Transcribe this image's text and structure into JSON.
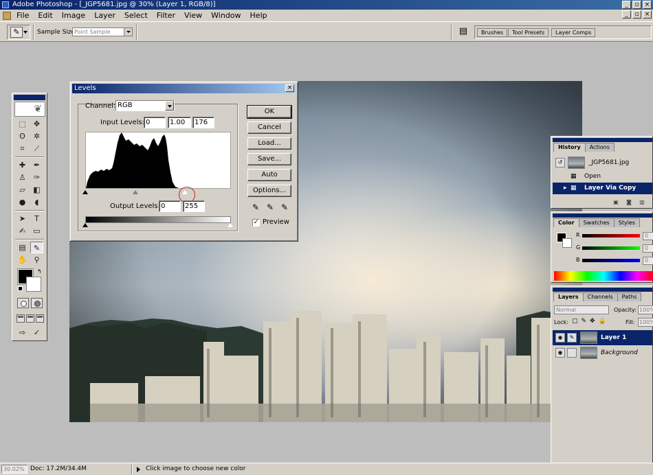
{
  "window": {
    "title": "Adobe Photoshop - [_JGP5681.jpg @ 30% (Layer 1, RGB/8)]"
  },
  "menu": [
    "File",
    "Edit",
    "Image",
    "Layer",
    "Select",
    "Filter",
    "View",
    "Window",
    "Help"
  ],
  "options_bar": {
    "sample_size_label": "Sample Size:",
    "sample_size_value": "Point Sample",
    "palette_well_tabs": [
      "Brushes",
      "Tool Presets",
      "Layer Comps"
    ]
  },
  "levels_dialog": {
    "title": "Levels",
    "channel_label": "Channel:",
    "channel_value": "RGB",
    "input_levels_label": "Input Levels:",
    "input_black": "0",
    "input_gamma": "1.00",
    "input_white": "176",
    "output_levels_label": "Output Levels:",
    "output_black": "0",
    "output_white": "255",
    "buttons": {
      "ok": "OK",
      "cancel": "Cancel",
      "load": "Load...",
      "save": "Save...",
      "auto": "Auto",
      "options": "Options..."
    },
    "preview_label": "Preview",
    "preview_checked": true
  },
  "history_panel": {
    "tabs": [
      "History",
      "Actions"
    ],
    "snapshot": "_JGP5681.jpg",
    "states": [
      "Open",
      "Layer Via Copy"
    ]
  },
  "color_panel": {
    "tabs": [
      "Color",
      "Swatches",
      "Styles"
    ],
    "channels": [
      {
        "label": "R",
        "value": "0",
        "color": "#c00000"
      },
      {
        "label": "G",
        "value": "0",
        "color": "#00a000"
      },
      {
        "label": "B",
        "value": "0",
        "color": "#0000c0"
      }
    ]
  },
  "layers_panel": {
    "tabs": [
      "Layers",
      "Channels",
      "Paths"
    ],
    "blend_mode": "Normal",
    "opacity_label": "Opacity:",
    "opacity_value": "100%",
    "lock_label": "Lock:",
    "fill_label": "Fill:",
    "fill_value": "100%",
    "layers": [
      {
        "name": "Layer 1",
        "selected": true
      },
      {
        "name": "Background",
        "selected": false
      }
    ]
  },
  "status_bar": {
    "zoom": "30.02%",
    "doc_info": "Doc: 17.2M/34.4M",
    "hint": "Click image to choose new color"
  }
}
